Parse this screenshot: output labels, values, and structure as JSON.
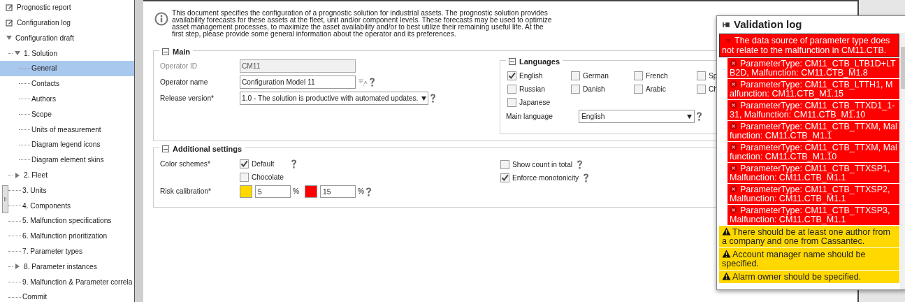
{
  "sidebar": {
    "items": [
      {
        "kind": "link",
        "label": "Prognostic report",
        "selected": false
      },
      {
        "kind": "link",
        "label": "Configuration log",
        "selected": false
      },
      {
        "kind": "node",
        "label": "Configuration draft",
        "selected": false,
        "expanded": true,
        "children": [
          {
            "kind": "node",
            "label": "1. Solution",
            "selected": false,
            "expanded": true,
            "children": [
              {
                "kind": "leaf",
                "label": "General",
                "selected": true
              },
              {
                "kind": "leaf",
                "label": "Contacts",
                "selected": false
              },
              {
                "kind": "leaf",
                "label": "Authors",
                "selected": false
              },
              {
                "kind": "leaf",
                "label": "Scope",
                "selected": false
              },
              {
                "kind": "leaf",
                "label": "Units of measurement",
                "selected": false
              },
              {
                "kind": "leaf",
                "label": "Diagram legend icons",
                "selected": false
              },
              {
                "kind": "leaf",
                "label": "Diagram element skins",
                "selected": false
              }
            ]
          },
          {
            "kind": "node",
            "label": "2. Fleet",
            "selected": false,
            "expanded": false
          },
          {
            "kind": "leaf",
            "label": "3. Units",
            "selected": false
          },
          {
            "kind": "leaf",
            "label": "4. Components",
            "selected": false
          },
          {
            "kind": "leaf",
            "label": "5. Malfunction specifications",
            "selected": false
          },
          {
            "kind": "leaf",
            "label": "6. Malfunction prioritization",
            "selected": false
          },
          {
            "kind": "leaf",
            "label": "7. Parameter types",
            "selected": false
          },
          {
            "kind": "node",
            "label": "8. Parameter instances",
            "selected": false,
            "expanded": false
          },
          {
            "kind": "leaf",
            "label": "9. Malfunction & Parameter correla",
            "selected": false
          },
          {
            "kind": "leaf",
            "label": "Commit",
            "selected": false
          }
        ]
      }
    ]
  },
  "info": "This document specifies the configuration of a prognostic solution for industrial assets. The prognostic solution provides availability forecasts for these assets at the fleet, unit and/or component levels. These forecasts may be used to optimize asset management processes, to maximize the asset availability and/or to best utilize their remaining useful life. At the first step, please provide some general information about the operator and its preferences.",
  "main": {
    "title": "Main",
    "expanded": true,
    "fields": [
      {
        "kind": "text",
        "label": "Operator ID",
        "value": "CM11",
        "disabled": true,
        "help": false,
        "translate": false
      },
      {
        "kind": "text",
        "label": "Operator name",
        "value": "Configuration Model 11",
        "disabled": false,
        "help": true,
        "translate": true
      },
      {
        "kind": "select",
        "label": "Release version*",
        "value": "1.0 - The solution is productive with automated updates.",
        "disabled": false,
        "help": true,
        "translate": false
      }
    ],
    "languages": {
      "title": "Languages",
      "expanded": true,
      "options": [
        {
          "label": "English",
          "checked": true
        },
        {
          "label": "German",
          "checked": false
        },
        {
          "label": "French",
          "checked": false
        },
        {
          "label": "Sp",
          "checked": false
        },
        {
          "label": "Russian",
          "checked": false
        },
        {
          "label": "Danish",
          "checked": false
        },
        {
          "label": "Arabic",
          "checked": false
        },
        {
          "label": "Ch",
          "checked": false
        },
        {
          "label": "Japanese",
          "checked": false
        }
      ],
      "main_language": {
        "label": "Main language",
        "value": "English"
      }
    }
  },
  "additional": {
    "title": "Additional settings",
    "expanded": true,
    "color_schemes": {
      "label": "Color schemes*",
      "options": [
        {
          "label": "Default",
          "checked": true
        },
        {
          "label": "Chocolate",
          "checked": false
        }
      ]
    },
    "risk_calibration": {
      "label": "Risk calibration*",
      "levels": [
        {
          "color": "#ffd800",
          "value": "5",
          "unit": "%"
        },
        {
          "color": "#ff0000",
          "value": "15",
          "unit": "%"
        }
      ]
    },
    "switches": [
      {
        "label": "Show count in total",
        "checked": false
      },
      {
        "label": "Enforce monotonicity",
        "checked": true
      }
    ]
  },
  "validation_log": {
    "title": "Validation log",
    "entries": [
      {
        "kind": "error",
        "text": "The data source of parameter type does not relate to the malfunction in CM11.CTB.",
        "expanded": true,
        "children": [
          {
            "text": "ParameterType: CM11_CTB_LTB1D+LTB2D, Malfunction: CM11.CTB_M1.8"
          },
          {
            "text": "ParameterType: CM11_CTB_LTTH1, Malfunction: CM11.CTB_M1.15"
          },
          {
            "text": "ParameterType: CM11_CTB_TTXD1_1-31, Malfunction: CM11.CTB_M1.10"
          },
          {
            "text": "ParameterType: CM11_CTB_TTXM, Malfunction: CM11.CTB_M1.1"
          },
          {
            "text": "ParameterType: CM11_CTB_TTXM, Malfunction: CM11.CTB_M1.10"
          },
          {
            "text": "ParameterType: CM11_CTB_TTXSP1, Malfunction: CM11.CTB_M1.1"
          },
          {
            "text": "ParameterType: CM11_CTB_TTXSP2, Malfunction: CM11.CTB_M1.1"
          },
          {
            "text": "ParameterType: CM11_CTB_TTXSP3, Malfunction: CM11.CTB_M1.1"
          }
        ]
      },
      {
        "kind": "warning",
        "text": "There should be at least one author from a company and one from Cassantec."
      },
      {
        "kind": "warning",
        "text": "Account manager name should be specified."
      },
      {
        "kind": "warning",
        "text": "Alarm owner should be specified."
      }
    ]
  }
}
